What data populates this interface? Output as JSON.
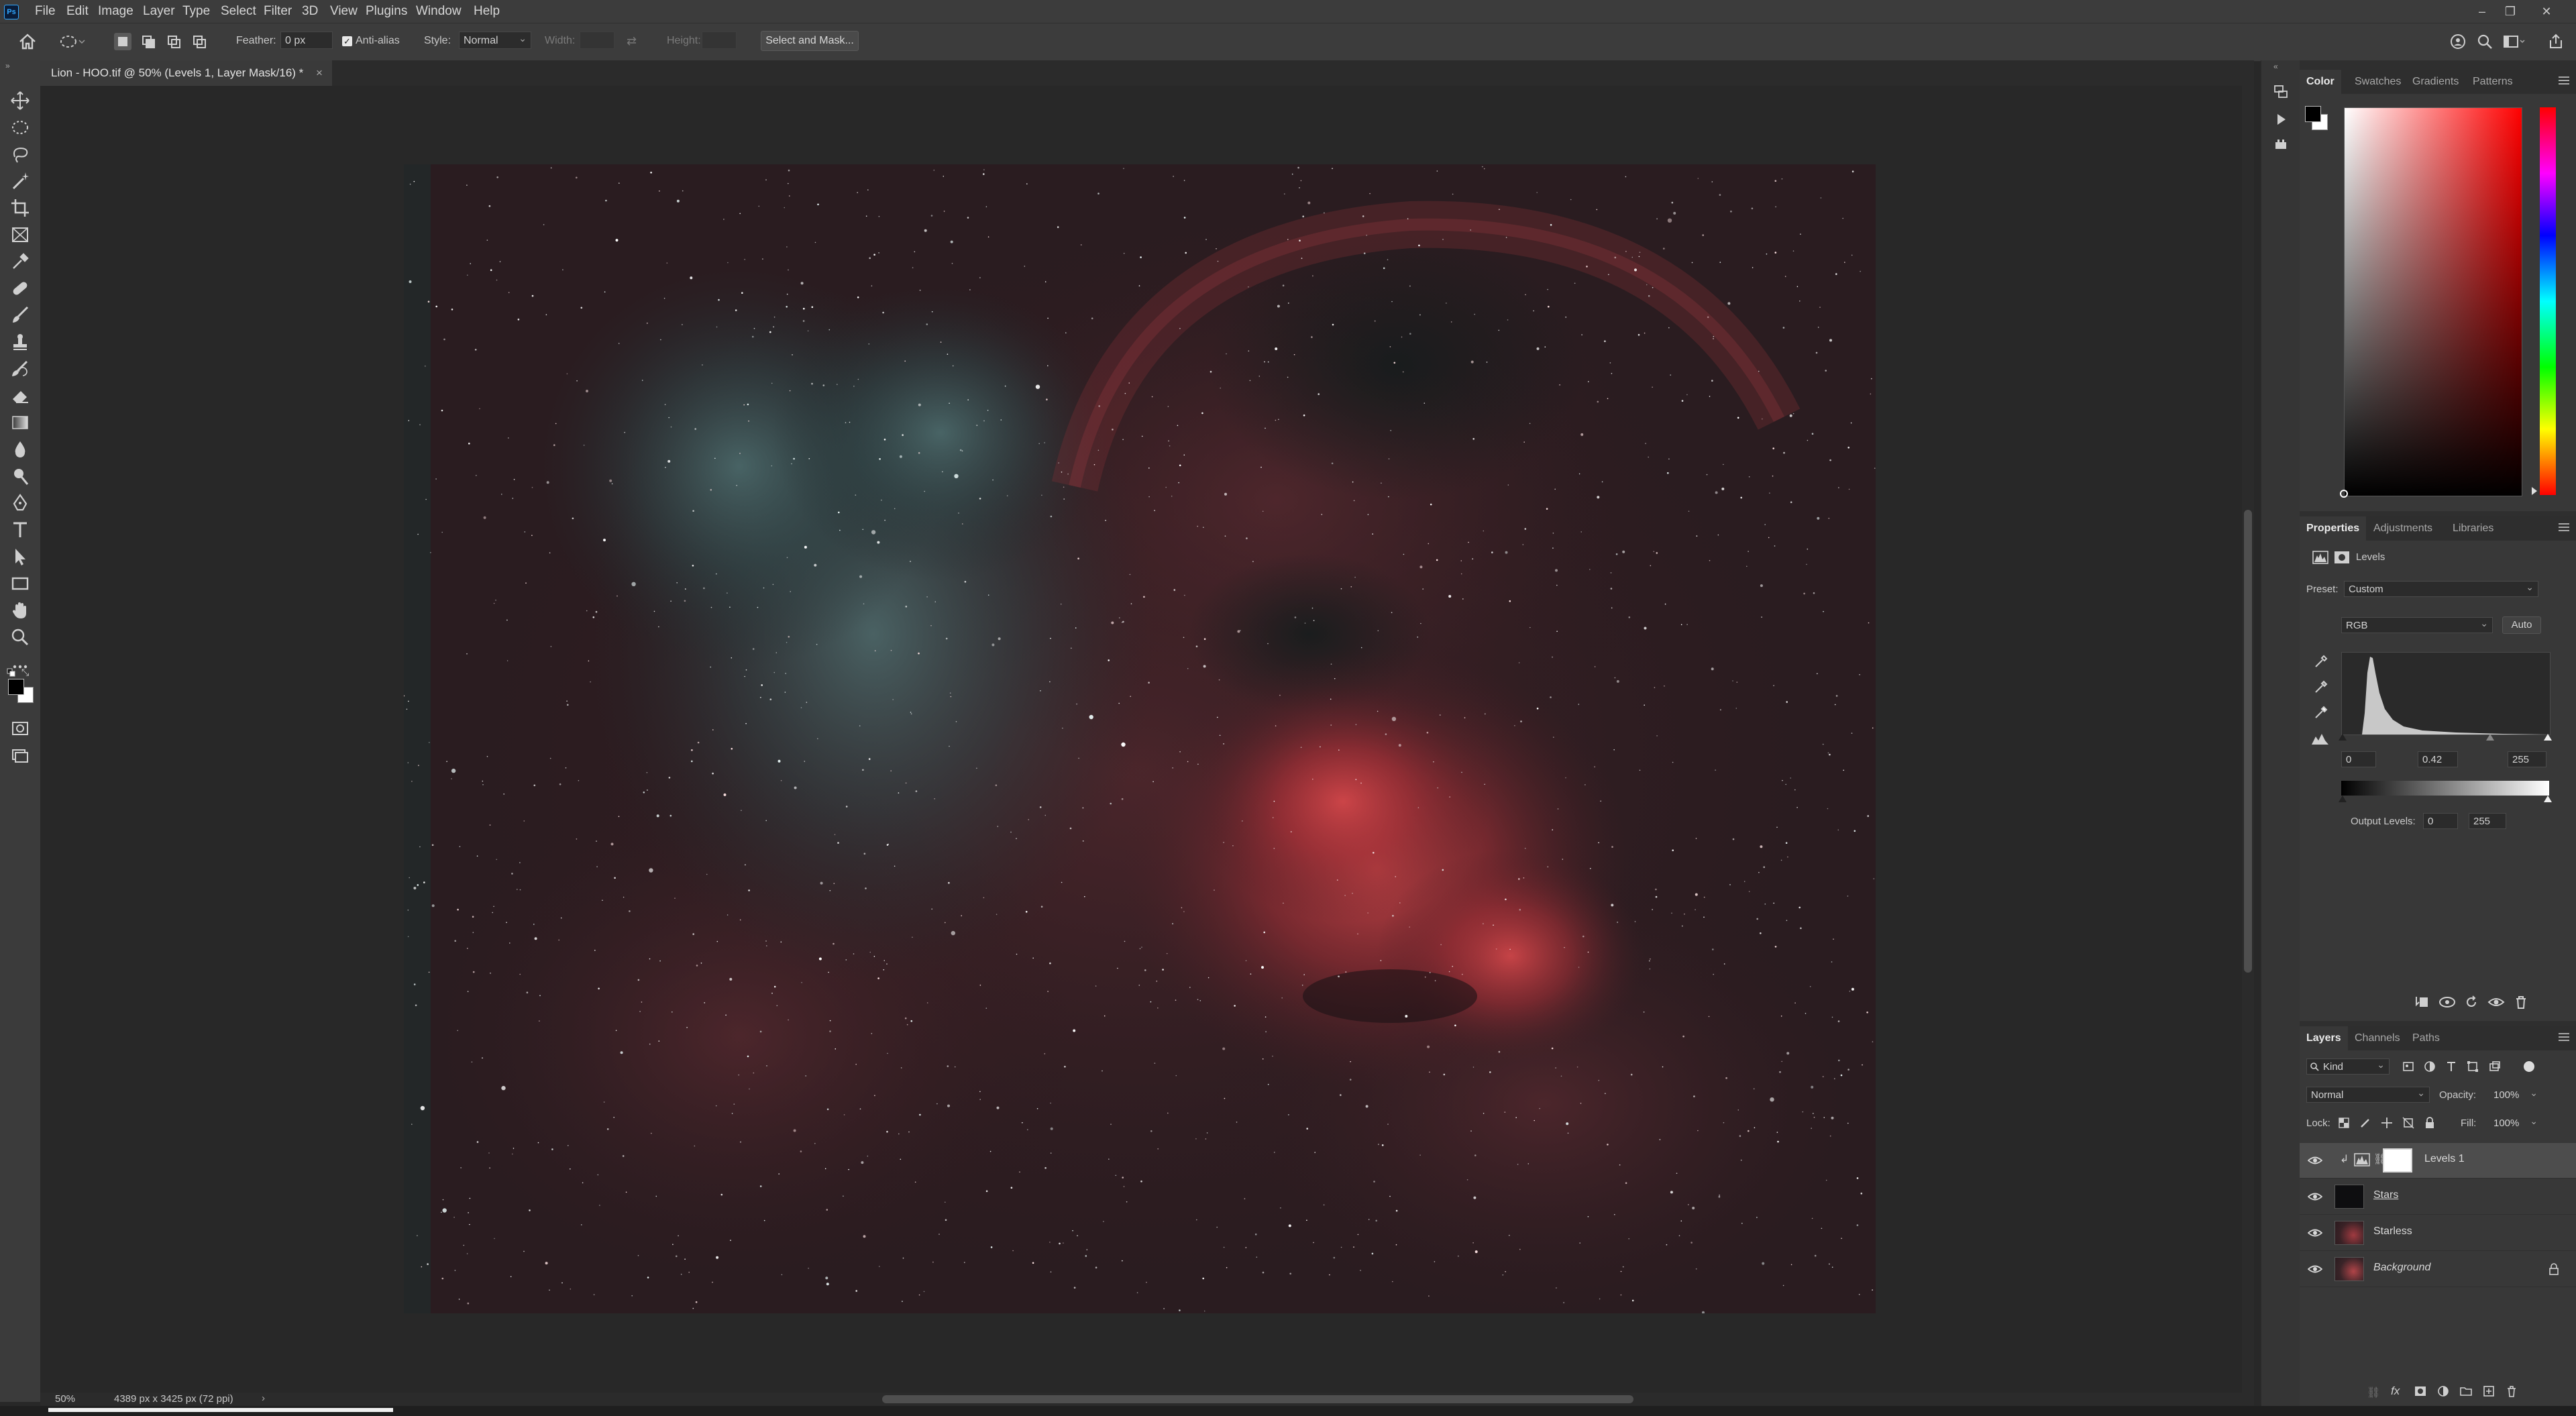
{
  "app": {
    "logo_text": "Ps",
    "menus": [
      "File",
      "Edit",
      "Image",
      "Layer",
      "Type",
      "Select",
      "Filter",
      "3D",
      "View",
      "Plugins",
      "Window",
      "Help"
    ]
  },
  "options_bar": {
    "feather_label": "Feather:",
    "feather_value": "0 px",
    "antialias_label": "Anti-alias",
    "antialias_checked": true,
    "style_label": "Style:",
    "style_value": "Normal",
    "width_label": "Width:",
    "height_label": "Height:",
    "select_mask_label": "Select and Mask..."
  },
  "document": {
    "tab_title": "Lion - HOO.tif @ 50% (Levels 1, Layer Mask/16) *",
    "close_glyph": "×"
  },
  "status": {
    "zoom": "50%",
    "doc_info": "4389 px x 3425 px (72 ppi)",
    "arrow": "›"
  },
  "color_panel": {
    "tabs": [
      "Color",
      "Swatches",
      "Gradients",
      "Patterns"
    ],
    "active_tab": "Color",
    "foreground": "#000000",
    "background": "#ffffff",
    "hue_color": "#ff0000"
  },
  "properties_panel": {
    "tabs": [
      "Properties",
      "Adjustments",
      "Libraries"
    ],
    "active_tab": "Properties",
    "adjustment_title": "Levels",
    "preset_label": "Preset:",
    "preset_value": "Custom",
    "channel_value": "RGB",
    "auto_label": "Auto",
    "input_black": "0",
    "input_gamma": "0.42",
    "input_white": "255",
    "output_label": "Output Levels:",
    "output_black": "0",
    "output_white": "255"
  },
  "layers_panel": {
    "tabs": [
      "Layers",
      "Channels",
      "Paths"
    ],
    "active_tab": "Layers",
    "filter_label": "Kind",
    "blend_mode": "Normal",
    "opacity_label": "Opacity:",
    "opacity_value": "100%",
    "lock_label": "Lock:",
    "fill_label": "Fill:",
    "fill_value": "100%",
    "layers": [
      {
        "name": "Levels 1",
        "selected": true,
        "visible": true
      },
      {
        "name": "Stars",
        "selected": false,
        "visible": true
      },
      {
        "name": "Starless",
        "selected": false,
        "visible": true
      },
      {
        "name": "Background",
        "selected": false,
        "visible": true,
        "locked": true
      }
    ]
  },
  "colors": {
    "ui_dark": "#282828",
    "panel": "#383838",
    "accent_blue": "#2f6ecb"
  }
}
